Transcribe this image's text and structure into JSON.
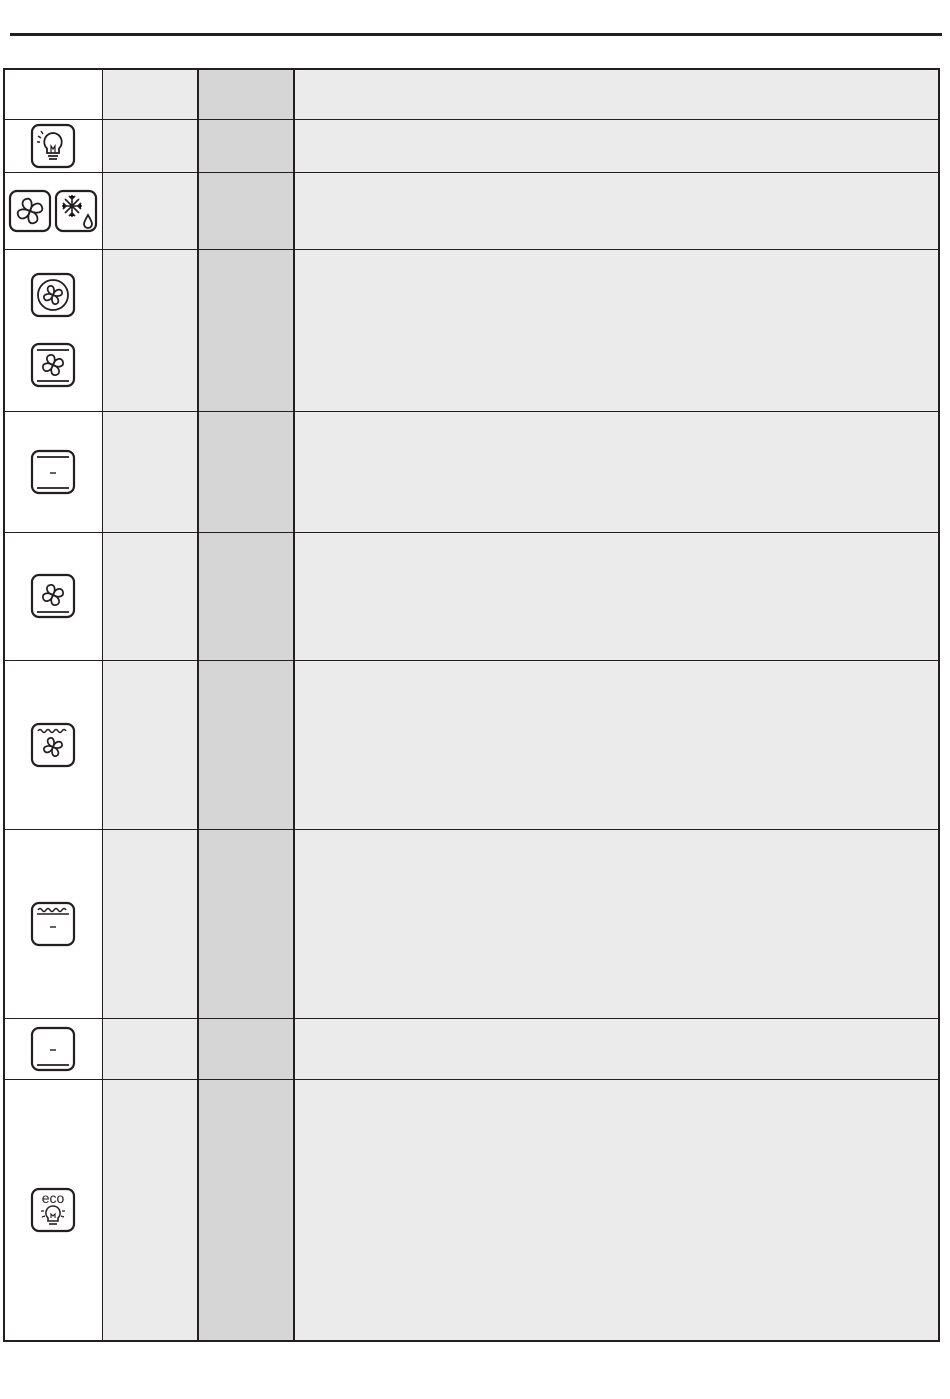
{
  "rows": [
    {
      "icons": [
        "lamp-icon"
      ],
      "function": "",
      "temperature": "",
      "description": ""
    },
    {
      "icons": [
        "fan-icon",
        "defrost-icon"
      ],
      "function": "",
      "temperature": "",
      "description": ""
    },
    {
      "icons": [
        "circular-fan-icon",
        "fan-bottom-heat-icon"
      ],
      "function": "",
      "temperature": "",
      "description": ""
    },
    {
      "icons": [
        "top-bottom-heat-icon"
      ],
      "function": "",
      "temperature": "",
      "description": ""
    },
    {
      "icons": [
        "fan-bottom-heat-icon"
      ],
      "function": "",
      "temperature": "",
      "description": ""
    },
    {
      "icons": [
        "fan-grill-icon"
      ],
      "function": "",
      "temperature": "",
      "description": ""
    },
    {
      "icons": [
        "grill-icon"
      ],
      "function": "",
      "temperature": "",
      "description": ""
    },
    {
      "icons": [
        "bottom-heat-icon"
      ],
      "function": "",
      "temperature": "",
      "description": ""
    },
    {
      "icons": [
        "eco-light-icon"
      ],
      "function": "",
      "temperature": "",
      "description": "",
      "icon_text": "eco"
    }
  ]
}
